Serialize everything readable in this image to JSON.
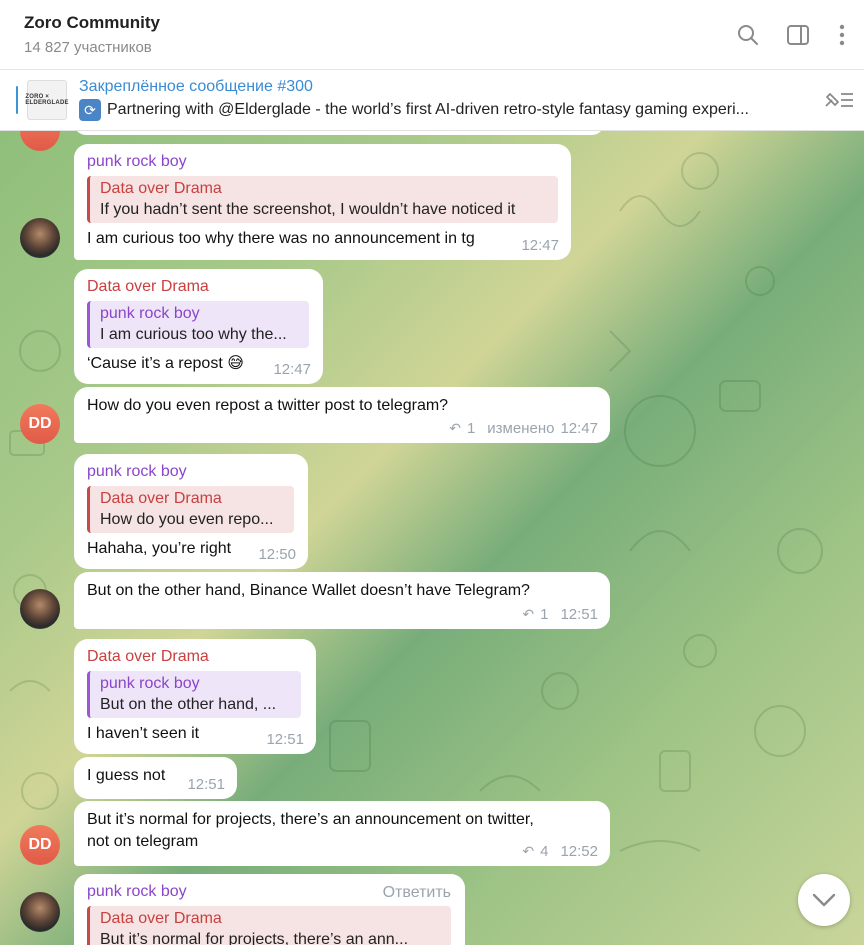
{
  "header": {
    "title": "Zoro Community",
    "members": "14 827 участников",
    "icons": [
      "search-icon",
      "sidebar-icon",
      "more-icon"
    ]
  },
  "pinned": {
    "title": "Закреплённое сообщение #300",
    "text": "Partnering with @Elderglade - the world’s first AI-driven retro-style fantasy gaming experi...",
    "thumb_text": "ZORO × ELDERGLADE"
  },
  "messages": [
    {
      "sender": "punk rock boy",
      "quote_name": "Data over Drama",
      "quote_text": "If you hadn’t sent the screenshot, I wouldn’t have noticed it",
      "text": "I am curious too why there was no announcement in tg",
      "time": "12:47"
    },
    {
      "sender": "Data over Drama",
      "quote_name": "punk rock boy",
      "quote_text": "I am curious too why the...",
      "text": "‘Cause it’s a repost 😅",
      "time": "12:47"
    },
    {
      "text": "How do you even repost a twitter post to telegram?",
      "replies": "1",
      "edited": "изменено",
      "time": "12:47"
    },
    {
      "sender": "punk rock boy",
      "quote_name": "Data over Drama",
      "quote_text": "How do you even repo...",
      "text": "Hahaha, you’re right",
      "time": "12:50"
    },
    {
      "text": "But on the other hand, Binance Wallet doesn’t have Telegram?",
      "replies": "1",
      "time": "12:51"
    },
    {
      "sender": "Data over Drama",
      "quote_name": "punk rock boy",
      "quote_text": "But on the other hand, ...",
      "text": "I haven’t seen it",
      "time": "12:51"
    },
    {
      "text": "I guess not",
      "time": "12:51"
    },
    {
      "text_line1": "But it’s normal for projects,  there’s an announcement on twitter,",
      "text_line2": "not on telegram",
      "replies": "4",
      "time": "12:52"
    },
    {
      "sender": "punk rock boy",
      "reply_action": "Ответить",
      "quote_name": "Data over Drama",
      "quote_text": "But it’s normal for projects,  there’s an ann..."
    }
  ],
  "avatars": {
    "dd_initials": "DD"
  },
  "colors": {
    "accent": "#3a8bd5",
    "purple": "#8a45c9",
    "red": "#c94040",
    "meta": "#9aa4ad"
  }
}
